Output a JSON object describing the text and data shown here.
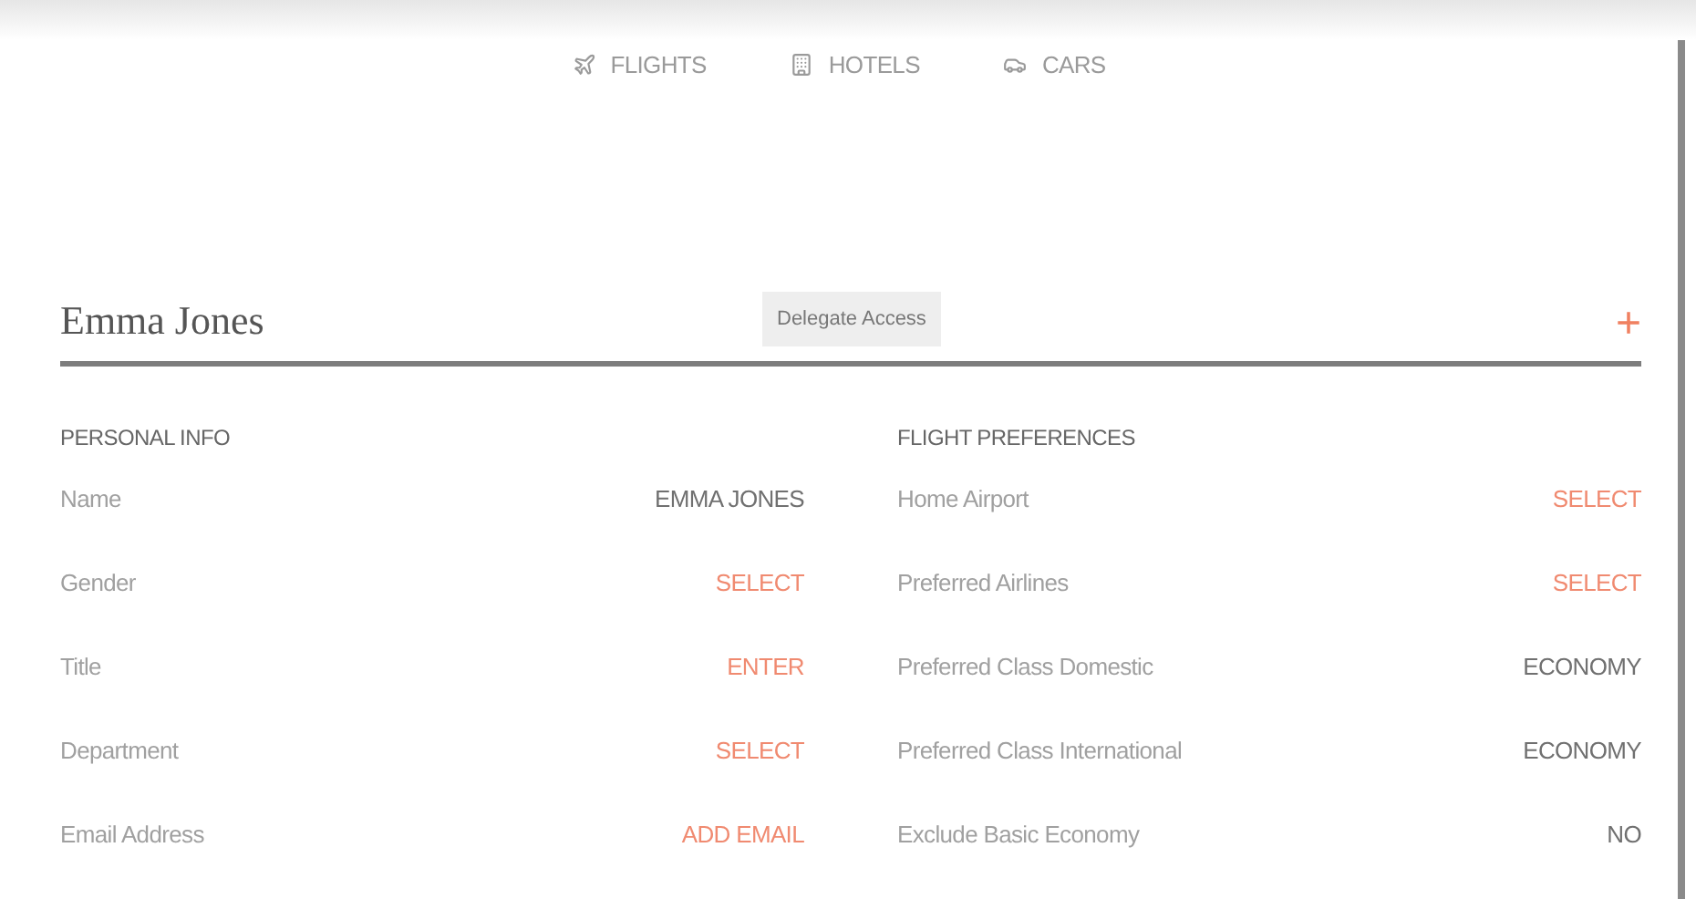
{
  "tabs": [
    {
      "label": "FLIGHTS",
      "kind": "flights"
    },
    {
      "label": "HOTELS",
      "kind": "hotels"
    },
    {
      "label": "CARS",
      "kind": "cars"
    }
  ],
  "profile": {
    "name": "Emma Jones",
    "delegate_button": "Delegate Access",
    "add_button": "+"
  },
  "sections": [
    {
      "title": "PERSONAL INFO",
      "rows": [
        {
          "label": "Name",
          "value": "EMMA JONES",
          "kind": "value"
        },
        {
          "label": "Gender",
          "value": "SELECT",
          "kind": "action"
        },
        {
          "label": "Title",
          "value": "ENTER",
          "kind": "action"
        },
        {
          "label": "Department",
          "value": "SELECT",
          "kind": "action"
        },
        {
          "label": "Email Address",
          "value": "ADD EMAIL",
          "kind": "action"
        }
      ]
    },
    {
      "title": "FLIGHT PREFERENCES",
      "rows": [
        {
          "label": "Home Airport",
          "value": "SELECT",
          "kind": "action"
        },
        {
          "label": "Preferred Airlines",
          "value": "SELECT",
          "kind": "action"
        },
        {
          "label": "Preferred Class Domestic",
          "value": "ECONOMY",
          "kind": "value"
        },
        {
          "label": "Preferred Class International",
          "value": "ECONOMY",
          "kind": "value"
        },
        {
          "label": "Exclude Basic Economy",
          "value": "NO",
          "kind": "value"
        }
      ]
    }
  ]
}
